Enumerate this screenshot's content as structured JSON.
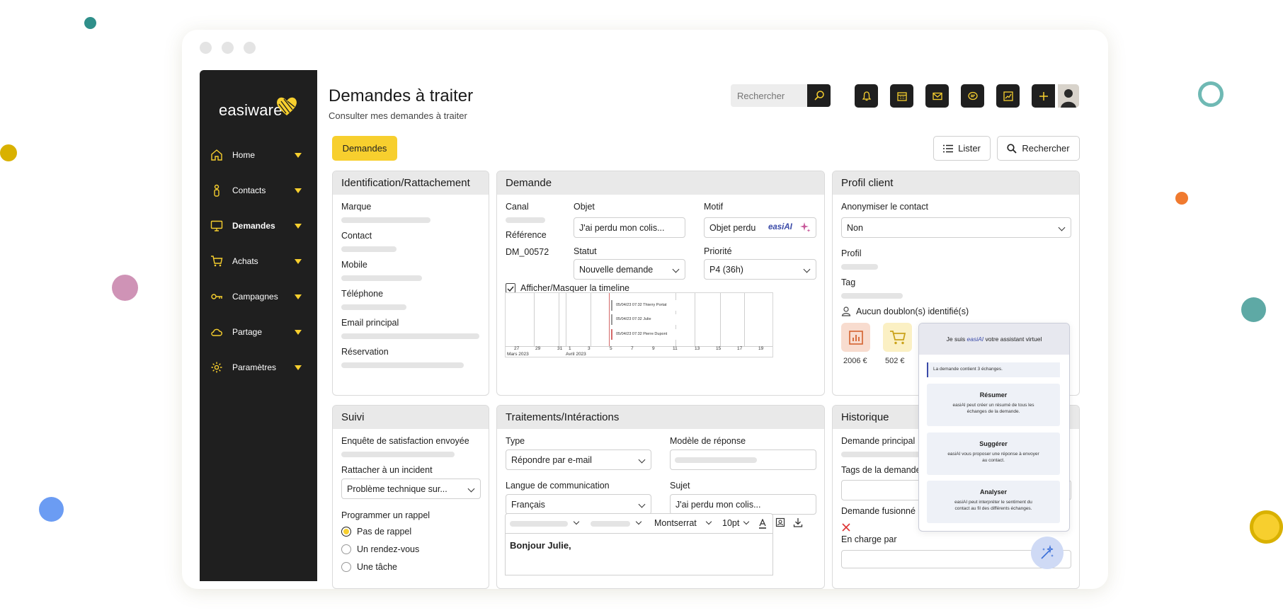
{
  "app": {
    "brand": "easiware",
    "title": "Demandes à traiter",
    "subtitle": "Consulter mes demandes à traiter"
  },
  "colors": {
    "accent": "#f7cf2e",
    "sidebar": "#1f1f1f",
    "ai": "#3a4aa8"
  },
  "sidebar": {
    "items": [
      {
        "label": "Home",
        "icon": "home-icon"
      },
      {
        "label": "Contacts",
        "icon": "person-icon"
      },
      {
        "label": "Demandes",
        "icon": "monitor-icon"
      },
      {
        "label": "Achats",
        "icon": "cart-icon"
      },
      {
        "label": "Campagnes",
        "icon": "key-icon"
      },
      {
        "label": "Partage",
        "icon": "cloud-icon"
      },
      {
        "label": "Paramètres",
        "icon": "gear-icon"
      }
    ]
  },
  "header": {
    "search_placeholder": "Rechercher",
    "icons": [
      "bell-icon",
      "calendar-icon",
      "mail-icon",
      "chat-icon",
      "chart-icon",
      "plus-icon"
    ]
  },
  "toolbar": {
    "demandes_label": "Demandes",
    "lister_label": "Lister",
    "rechercher_label": "Rechercher"
  },
  "identification": {
    "title": "Identification/Rattachement",
    "fields": [
      "Marque",
      "Contact",
      "Mobile",
      "Téléphone",
      "Email principal",
      "Réservation"
    ]
  },
  "demande": {
    "title": "Demande",
    "canal_label": "Canal",
    "reference_label": "Référence",
    "reference_value": "DM_00572",
    "objet_label": "Objet",
    "objet_value": "J'ai perdu mon colis...",
    "motif_label": "Motif",
    "motif_value": "Objet perdu",
    "easiai_tag": "easiAI",
    "statut_label": "Statut",
    "statut_value": "Nouvelle demande",
    "priorite_label": "Priorité",
    "priorite_value": "P4 (36h)",
    "timeline_toggle": "Afficher/Masquer la timeline",
    "timeline": {
      "ticks": [
        "27",
        "29",
        "31",
        "1",
        "3",
        "5",
        "7",
        "9",
        "11",
        "13",
        "15",
        "17",
        "19"
      ],
      "month1": "Mars 2023",
      "month2": "Avril 2023",
      "events": [
        "05/04/23 07:32 Thierry Portat",
        "05/04/23 07:32 Julie",
        "05/04/23 07:32 Pierre Dupont"
      ]
    }
  },
  "profil": {
    "title": "Profil client",
    "anonymiser_label": "Anonymiser le contact",
    "anonymiser_value": "Non",
    "profil_label": "Profil",
    "tag_label": "Tag",
    "doublon_text": "Aucun doublon(s) identifié(s)",
    "kpi1_value": "2006 €",
    "kpi2_value": "502 €"
  },
  "suivi": {
    "title": "Suivi",
    "enquete_label": "Enquête de satisfaction envoyée",
    "incident_label": "Rattacher à un incident",
    "incident_value": "Problème technique sur...",
    "rappel_label": "Programmer un rappel",
    "options": [
      "Pas de rappel",
      "Un rendez-vous",
      "Une tâche"
    ]
  },
  "traitements": {
    "title": "Traitements/Intéractions",
    "type_label": "Type",
    "type_value": "Répondre par e-mail",
    "modele_label": "Modèle de réponse",
    "langue_label": "Langue de communication",
    "langue_value": "Français",
    "sujet_label": "Sujet",
    "sujet_value": "J'ai perdu mon colis...",
    "font_name": "Montserrat",
    "font_size": "10pt",
    "body_text": "Bonjour Julie,"
  },
  "historique": {
    "title": "Historique",
    "demande_principale_label": "Demande principal",
    "tags_label": "Tags de la demande",
    "fusionnee_label": "Demande fusionné",
    "encharge_label": "En charge par"
  },
  "assistant": {
    "intro_prefix": "Je suis",
    "intro_brand": "easiAI",
    "intro_suffix": "votre assistant virtuel",
    "info": "La demande contient 3 échanges.",
    "cards": [
      {
        "title": "Résumer",
        "desc": "easiAI peut créer un résumé de tous les échanges de la demande."
      },
      {
        "title": "Suggérer",
        "desc": "easiAI vous proposer une réponse à envoyer au contact."
      },
      {
        "title": "Analyser",
        "desc": "easiAI peut interpréter le sentiment du contact au fil des différents échanges."
      }
    ]
  }
}
